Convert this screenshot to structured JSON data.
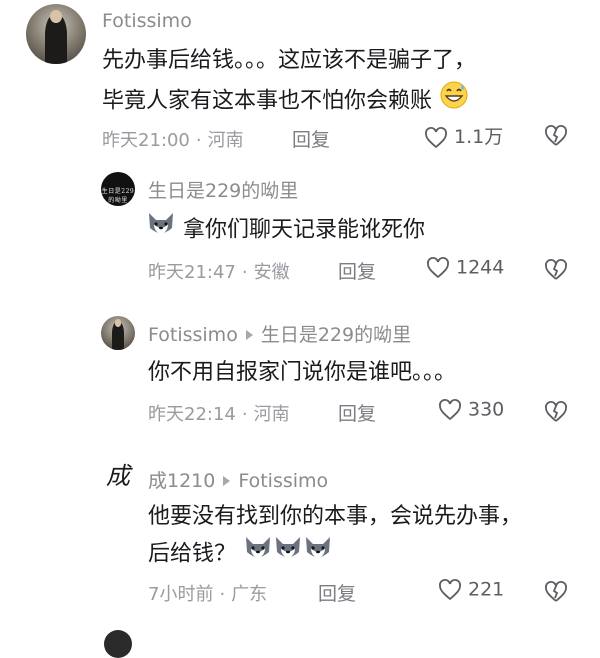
{
  "comments": [
    {
      "username": "Fotissimo",
      "text_line1": "先办事后给钱。。。这应该不是骗子了，",
      "text_line2": "毕竟人家有这本事也不怕你会赖账",
      "time": "昨天21:00",
      "location": "河南",
      "reply_label": "回复",
      "likes": "1.1万",
      "inline_emoji": "grinning-sweat-emoji"
    },
    {
      "username": "生日是229的呦里",
      "avatar_text": "生日是229的呦里",
      "text": "拿你们聊天记录能讹死你",
      "time": "昨天21:47",
      "location": "安徽",
      "reply_label": "回复",
      "likes": "1244",
      "inline_emoji": "husky-dog-emoji"
    },
    {
      "username": "Fotissimo",
      "reply_to": "生日是229的呦里",
      "text": "你不用自报家门说你是谁吧。。。",
      "time": "昨天22:14",
      "location": "河南",
      "reply_label": "回复",
      "likes": "330"
    },
    {
      "username": "成1210",
      "avatar_char": "成",
      "reply_to": "Fotissimo",
      "text_line1": "他要没有找到你的本事，会说先办事，",
      "text_line2": "后给钱？",
      "time": "7小时前",
      "location": "广东",
      "reply_label": "回复",
      "likes": "221",
      "inline_emoji": "husky-dog-emoji"
    }
  ],
  "colors": {
    "text": "#1b1b1f",
    "secondary": "#9a9aa0",
    "like_icon": "#5d5d63"
  }
}
